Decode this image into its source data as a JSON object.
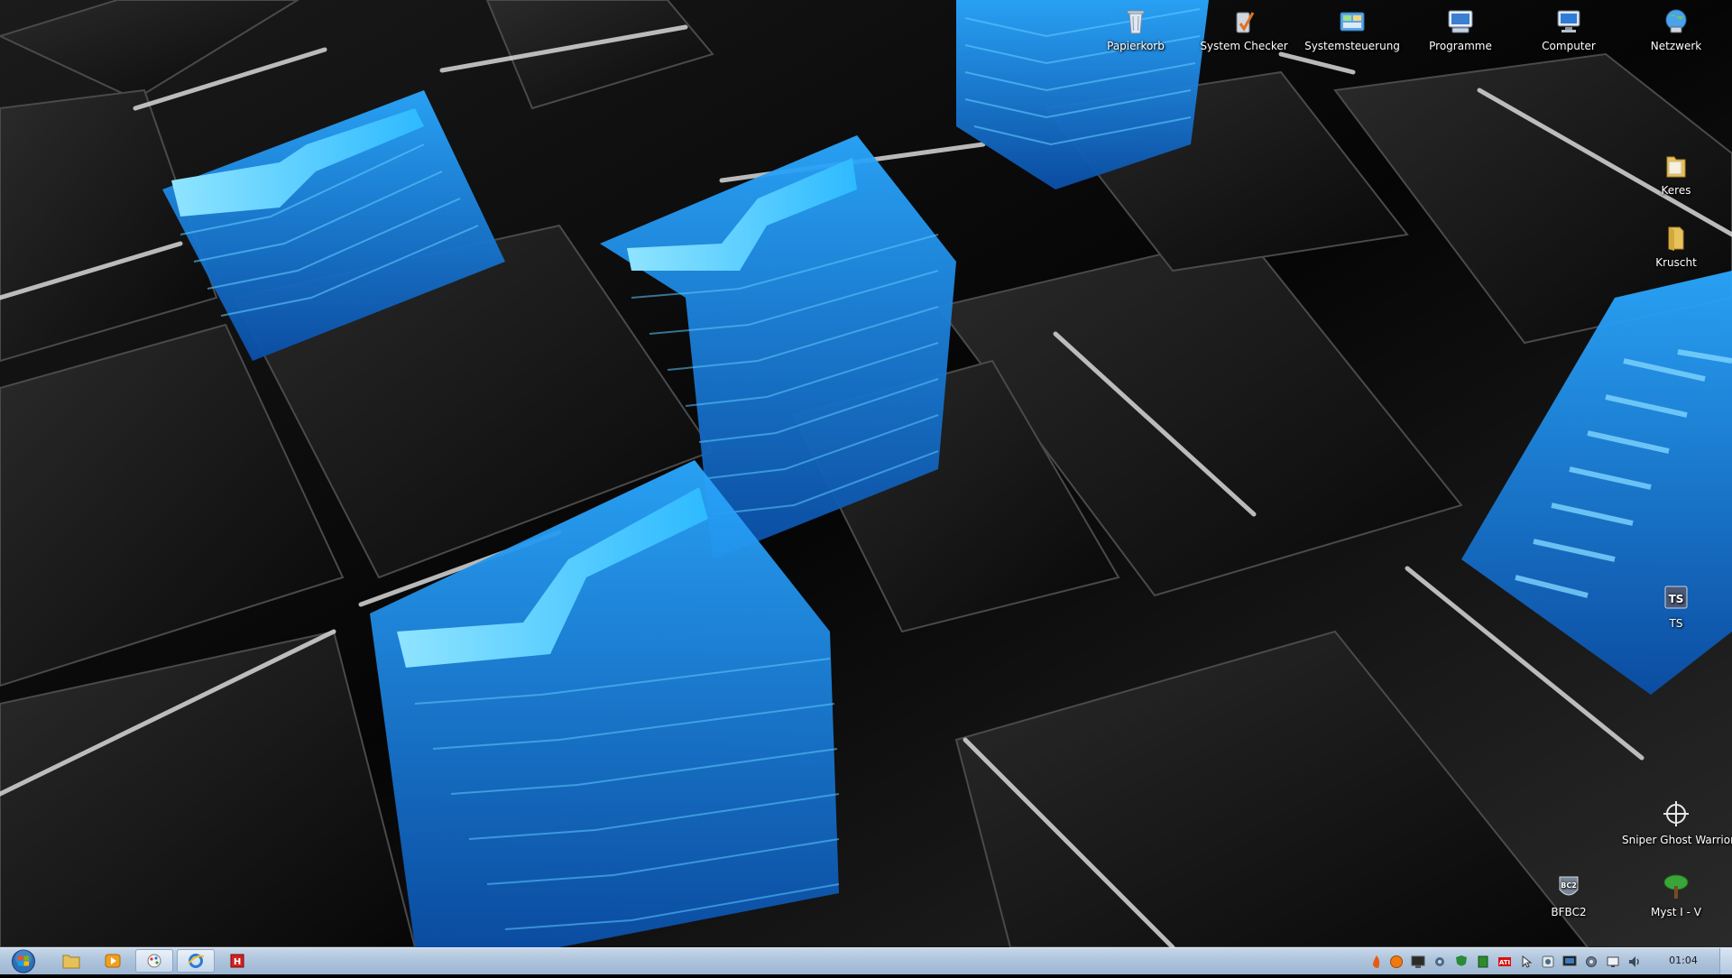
{
  "desktop": {
    "icons": [
      {
        "label": "Papierkorb",
        "icon": "recycle-bin-icon"
      },
      {
        "label": "System Checker",
        "icon": "system-checker-icon"
      },
      {
        "label": "Systemsteuerung",
        "icon": "control-panel-icon"
      },
      {
        "label": "Programme",
        "icon": "programs-icon"
      },
      {
        "label": "Computer",
        "icon": "computer-icon"
      },
      {
        "label": "Netzwerk",
        "icon": "network-icon"
      },
      {
        "label": "Keres",
        "icon": "folder-icon"
      },
      {
        "label": "Kruscht",
        "icon": "folder-icon"
      },
      {
        "label": "TS",
        "icon": "teamspeak-icon"
      },
      {
        "label": "Sniper Ghost Warrior",
        "icon": "crosshair-icon"
      },
      {
        "label": "BFBC2",
        "icon": "bfbc2-icon"
      },
      {
        "label": "Myst I - V",
        "icon": "tree-icon"
      }
    ]
  },
  "taskbar": {
    "pinned": [
      {
        "icon": "explorer-folder-icon"
      },
      {
        "icon": "media-player-icon"
      },
      {
        "icon": "paint-icon"
      },
      {
        "icon": "internet-explorer-icon"
      },
      {
        "icon": "red-app-icon"
      }
    ],
    "tray_icons": [
      "flame-icon",
      "orange-circle-icon",
      "monitor-icon",
      "network-gear-icon",
      "shield-icon",
      "green-square-icon",
      "ati-icon",
      "cursor-icon",
      "tray-app-icon",
      "tray-monitor-icon",
      "gear-icon",
      "display-icon",
      "volume-icon"
    ],
    "clock": "01:04"
  },
  "colors": {
    "accent_blue": "#1a8fe8",
    "taskbar": "#aec4dc"
  }
}
